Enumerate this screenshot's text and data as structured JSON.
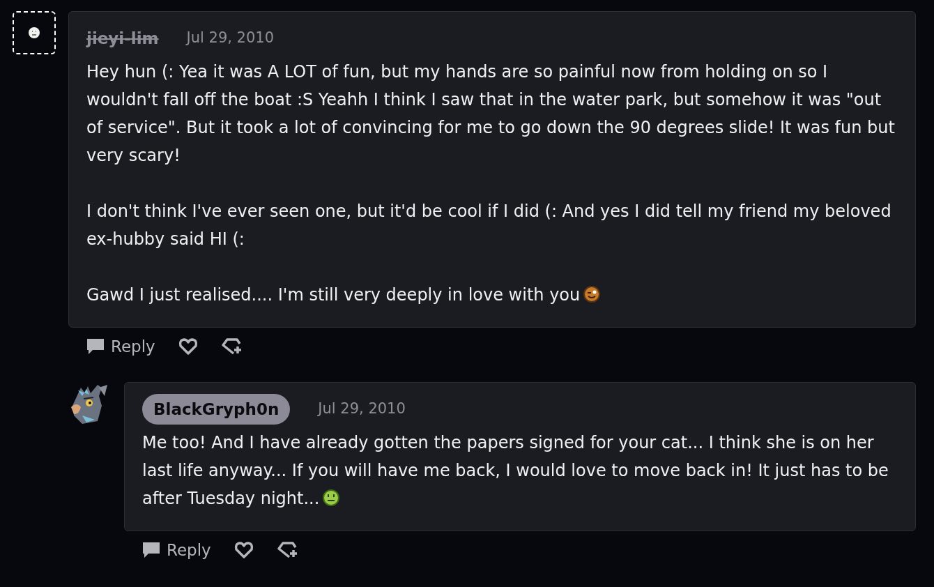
{
  "comments": [
    {
      "author": "jieyi-lim",
      "kind": "deleted",
      "date": "Jul 29, 2010",
      "paragraphs": [
        {
          "kind": "plain",
          "text": "Hey hun (: Yea it was A LOT of fun, but my hands are so painful now from holding on so I wouldn't fall off the boat :S Yeahh I think I saw that in the water park, but somehow it was \"out of service\". But it took a lot of convincing for me to go down the 90 degrees slide! It was fun but very scary!"
        },
        {
          "kind": "plain",
          "text": "I don't think I've ever seen one, but it'd be cool if I did (: And yes I did tell my friend my beloved ex-hubby said HI (:"
        },
        {
          "kind": "wink",
          "text": "Gawd I just realised.... I'm still very deeply in love with you"
        }
      ],
      "actions": {
        "reply": "Reply"
      },
      "replies": [
        {
          "author": "BlackGryph0n",
          "kind": "member",
          "date": "Jul 29, 2010",
          "paragraphs": [
            {
              "kind": "sick",
              "text": "Me too! And I have already gotten the papers signed for your cat... I think she is on her last life anyway... If you will have me back, I would love to move back in! It just has to be after Tuesday night..."
            }
          ],
          "actions": {
            "reply": "Reply"
          }
        }
      ]
    }
  ]
}
